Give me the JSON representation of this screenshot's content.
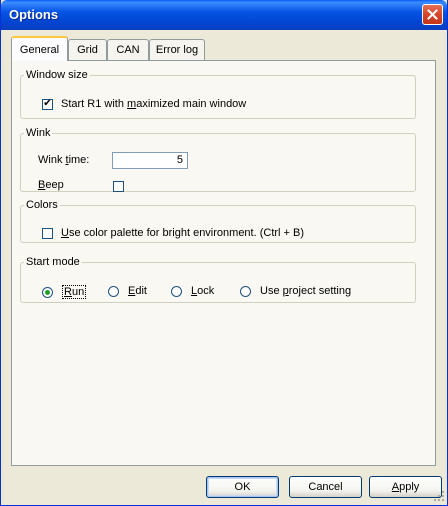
{
  "window": {
    "title": "Options"
  },
  "tabs": [
    {
      "label": "General",
      "active": true
    },
    {
      "label": "Grid",
      "active": false
    },
    {
      "label": "CAN",
      "active": false
    },
    {
      "label": "Error log",
      "active": false
    }
  ],
  "window_size": {
    "legend": "Window size",
    "maximized_label": "Start R1 with maximized main window",
    "maximized_checked": true
  },
  "wink": {
    "legend": "Wink",
    "time_label": "Wink time:",
    "time_value": "5",
    "beep_label": "Beep",
    "beep_checked": false
  },
  "colors": {
    "legend": "Colors",
    "bright_label": "Use color palette for bright environment. (Ctrl + B)",
    "bright_checked": false
  },
  "start_mode": {
    "legend": "Start mode",
    "options": [
      {
        "label": "Run",
        "selected": true
      },
      {
        "label": "Edit",
        "selected": false
      },
      {
        "label": "Lock",
        "selected": false
      },
      {
        "label": "Use project setting",
        "selected": false
      }
    ]
  },
  "buttons": {
    "ok": "OK",
    "cancel": "Cancel",
    "apply": "Apply"
  },
  "icons": {
    "close": "close-icon",
    "grip": "resize-grip-icon"
  },
  "colors_ui": {
    "titlebar": "#0654e4",
    "close": "#d8452a",
    "tab_highlight": "#ffc73c"
  }
}
